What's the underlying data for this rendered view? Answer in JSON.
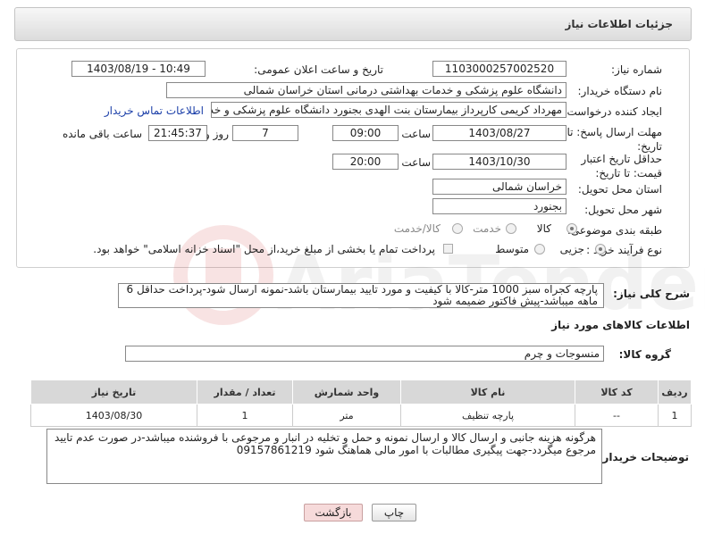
{
  "header": {
    "title": "جزئیات اطلاعات نیاز"
  },
  "form": {
    "need_number_label": "شماره نیاز:",
    "need_number": "1103000257002520",
    "announce_label": "تاریخ و ساعت اعلان عمومی:",
    "announce_value": "1403/08/19 - 10:49",
    "buyer_org_label": "نام دستگاه خریدار:",
    "buyer_org": "دانشگاه علوم پزشکی و خدمات بهداشتی درمانی استان خراسان شمالی",
    "creator_label": "ایجاد کننده درخواست:",
    "creator": "مهرداد کریمی کارپرداز بیمارستان بنت الهدی بجنورد دانشگاه علوم پزشکی و خد",
    "contact_link": "اطلاعات تماس خریدار",
    "deadline_label": "مهلت ارسال پاسخ: تا تاریخ:",
    "deadline_date": "1403/08/27",
    "time_word": "ساعت",
    "deadline_time": "09:00",
    "days_value": "7",
    "days_word": "روز و",
    "remaining_time": "21:45:37",
    "remaining_word": "ساعت باقی مانده",
    "validity_label": "حداقل تاریخ اعتبار قیمت: تا تاریخ:",
    "validity_date": "1403/10/30",
    "validity_time": "20:00",
    "province_label": "استان محل تحویل:",
    "province": "خراسان شمالی",
    "city_label": "شهر محل تحویل:",
    "city": "بجنورد",
    "category_label": "طبقه بندی موضوعی:",
    "category_options": [
      "کالا",
      "خدمت",
      "کالا/خدمت"
    ],
    "process_label": "نوع فرآیند خرید :",
    "process_options": [
      "جزیی",
      "متوسط"
    ],
    "process_note": "پرداخت تمام یا بخشی از مبلغ خرید،از محل \"اسناد خزانه اسلامی\" خواهد بود.",
    "description_label": "شرح کلی نیاز:",
    "description": "پارچه کجراه سبز 1000 متر-کالا با کیفیت و مورد تایید بیمارستان باشد-نمونه ارسال شود-پرداخت حداقل 6 ماهه میباشد-پیش فاکتور ضمیمه شود",
    "goods_info_title": "اطلاعات کالاهای مورد نیاز",
    "goods_group_label": "گروه کالا:",
    "goods_group": "منسوجات و چرم"
  },
  "table": {
    "headers": [
      "ردیف",
      "کد کالا",
      "نام کالا",
      "واحد شمارش",
      "تعداد / مقدار",
      "تاریخ نیاز"
    ],
    "rows": [
      [
        "1",
        "--",
        "پارچه تنظیف",
        "متر",
        "1",
        "1403/08/30"
      ]
    ]
  },
  "buyer_notes": {
    "label": "توضیحات خریدار:",
    "text": "هرگونه هزینه جانبی و ارسال کالا و ارسال نمونه و حمل و تخلیه در انبار و مرجوعی با فروشنده میباشد-در صورت عدم تایید مرجوع میگردد-جهت پیگیری مطالبات با امور مالی هماهنگ شود 09157861219"
  },
  "buttons": {
    "print": "چاپ",
    "back": "بازگشت"
  },
  "colors": {
    "accent_link": "#1a3ea8",
    "back_button_bg": "#f6dada",
    "header_bg": "#e6e6e6"
  }
}
